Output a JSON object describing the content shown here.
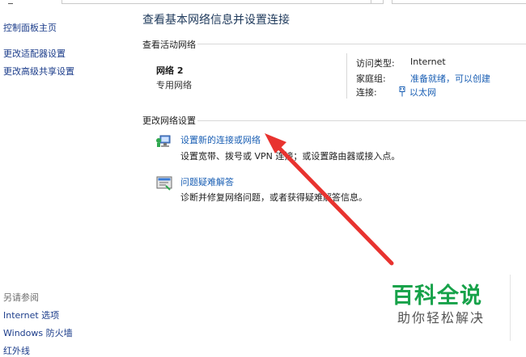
{
  "sidebar": {
    "home_link": "控制面板主页",
    "adapter_link": "更改适配器设置",
    "advanced_sharing_link": "更改高级共享设置",
    "see_also_label": "另请参阅",
    "internet_options": "Internet 选项",
    "windows_firewall": "Windows 防火墙",
    "partial_item": "红外线"
  },
  "main": {
    "title": "查看基本网络信息并设置连接",
    "active_networks_heading": "查看活动网络",
    "network": {
      "name": "网络  2",
      "type": "专用网络",
      "access_type_label": "访问类型:",
      "access_type_value": "Internet",
      "homegroup_label": "家庭组:",
      "homegroup_value": "准备就绪，可以创建",
      "connection_label": "连接:",
      "connection_value": "以太网"
    },
    "change_settings_heading": "更改网络设置",
    "tasks": [
      {
        "link": "设置新的连接或网络",
        "desc": "设置宽带、拨号或 VPN 连接；或设置路由器或接入点。",
        "icon": "network-setup-icon"
      },
      {
        "link": "问题疑难解答",
        "desc": "诊断并修复网络问题，或者获得疑难解答信息。",
        "icon": "troubleshoot-icon"
      }
    ]
  },
  "watermark": {
    "big": "百科全说",
    "small": "助你轻松解决"
  },
  "colors": {
    "link": "#1a5fb4",
    "title": "#1e395b",
    "arrow": "#e8332f",
    "watermark": "#17a24a"
  }
}
